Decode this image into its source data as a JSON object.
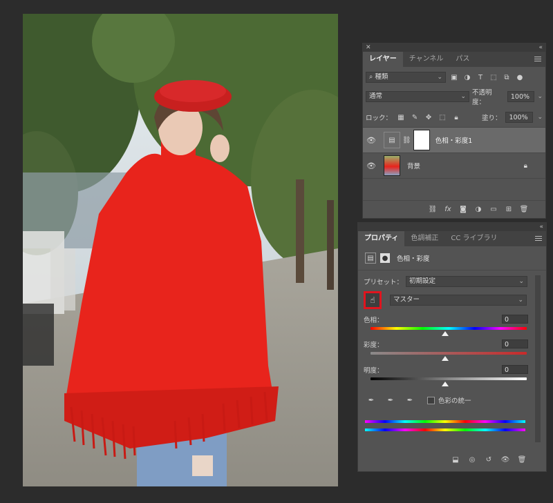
{
  "layers_panel": {
    "tabs": [
      "レイヤー",
      "チャンネル",
      "パス"
    ],
    "filter_label": "種類",
    "blend_mode": "通常",
    "opacity_label": "不透明度：",
    "opacity_value": "100%",
    "lock_label": "ロック：",
    "fill_label": "塗り：",
    "fill_value": "100%",
    "layers": [
      {
        "name": "色相・彩度1",
        "selected": true
      },
      {
        "name": "背景",
        "selected": false
      }
    ]
  },
  "properties_panel": {
    "tabs": [
      "プロパティ",
      "色調補正",
      "CC ライブラリ"
    ],
    "adjustment_title": "色相・彩度",
    "preset_label": "プリセット：",
    "preset_value": "初期設定",
    "channel_value": "マスター",
    "sliders": [
      {
        "label": "色相：",
        "value": "0"
      },
      {
        "label": "彩度：",
        "value": "0"
      },
      {
        "label": "明度：",
        "value": "0"
      }
    ],
    "colorize_label": "色彩の統一"
  },
  "colors": {
    "panel_bg": "#535353",
    "highlight_box": "#e0141e",
    "sweater": "#e8241c"
  },
  "icons": [
    "search-icon",
    "image-filter-icon",
    "adjust-filter-icon",
    "text-filter-icon",
    "shape-filter-icon",
    "smart-filter-icon",
    "eye-icon",
    "lock-icon",
    "link-icon",
    "fx-icon",
    "mask-icon",
    "folder-icon",
    "new-layer-icon",
    "trash-icon",
    "targeted-adjust-hand-icon",
    "eyedropper-icon",
    "clip-icon",
    "visibility-icon",
    "reset-icon",
    "view-previous-icon"
  ]
}
